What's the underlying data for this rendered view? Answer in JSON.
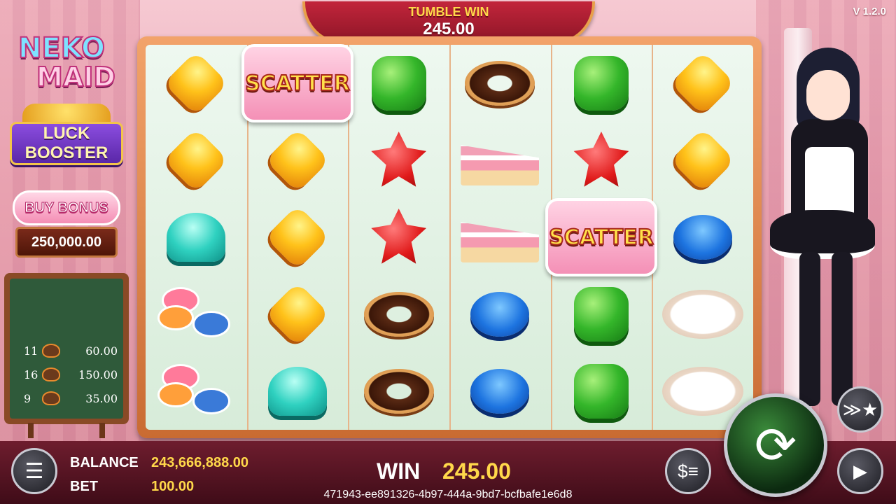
{
  "version": "V 1.2.0",
  "tumble": {
    "label": "TUMBLE WIN",
    "amount": "245.00"
  },
  "logo": {
    "line1": "NEKO",
    "line2": "MAID"
  },
  "luck_booster": {
    "line1": "LUCK",
    "line2": "BOOSTER"
  },
  "buy_bonus": {
    "label": "BUY BONUS",
    "price": "250,000.00"
  },
  "paytable": [
    {
      "count": "11",
      "amount": "60.00"
    },
    {
      "count": "16",
      "amount": "150.00"
    },
    {
      "count": "9",
      "amount": "35.00"
    }
  ],
  "scatter_label": "SCATTER",
  "grid": [
    [
      "yellow-gem",
      "scatter",
      "green-candy",
      "cat-donut",
      "green-candy",
      "yellow-gem"
    ],
    [
      "yellow-gem",
      "yellow-gem",
      "red-flower",
      "cat-cake",
      "red-flower",
      "yellow-gem"
    ],
    [
      "teal-candy",
      "yellow-gem",
      "red-flower",
      "cat-cake",
      "scatter",
      "blue-candy"
    ],
    [
      "macaron",
      "yellow-gem",
      "cat-donut",
      "blue-candy",
      "green-candy",
      "fruit-plate"
    ],
    [
      "macaron",
      "teal-candy",
      "cat-donut",
      "blue-candy",
      "green-candy",
      "fruit-plate"
    ]
  ],
  "footer": {
    "balance_label": "BALANCE",
    "balance_value": "243,666,888.00",
    "bet_label": "BET",
    "bet_value": "100.00",
    "win_label": "WIN",
    "win_value": "245.00",
    "round_id": "471943-ee891326-4b97-444a-9bd7-bcfbafe1e6d8"
  },
  "icons": {
    "menu": "hamburger-icon",
    "bet": "coin-stack-icon",
    "spin": "refresh-icon",
    "turbo": "turbo-icon",
    "autoplay": "play-icon"
  }
}
